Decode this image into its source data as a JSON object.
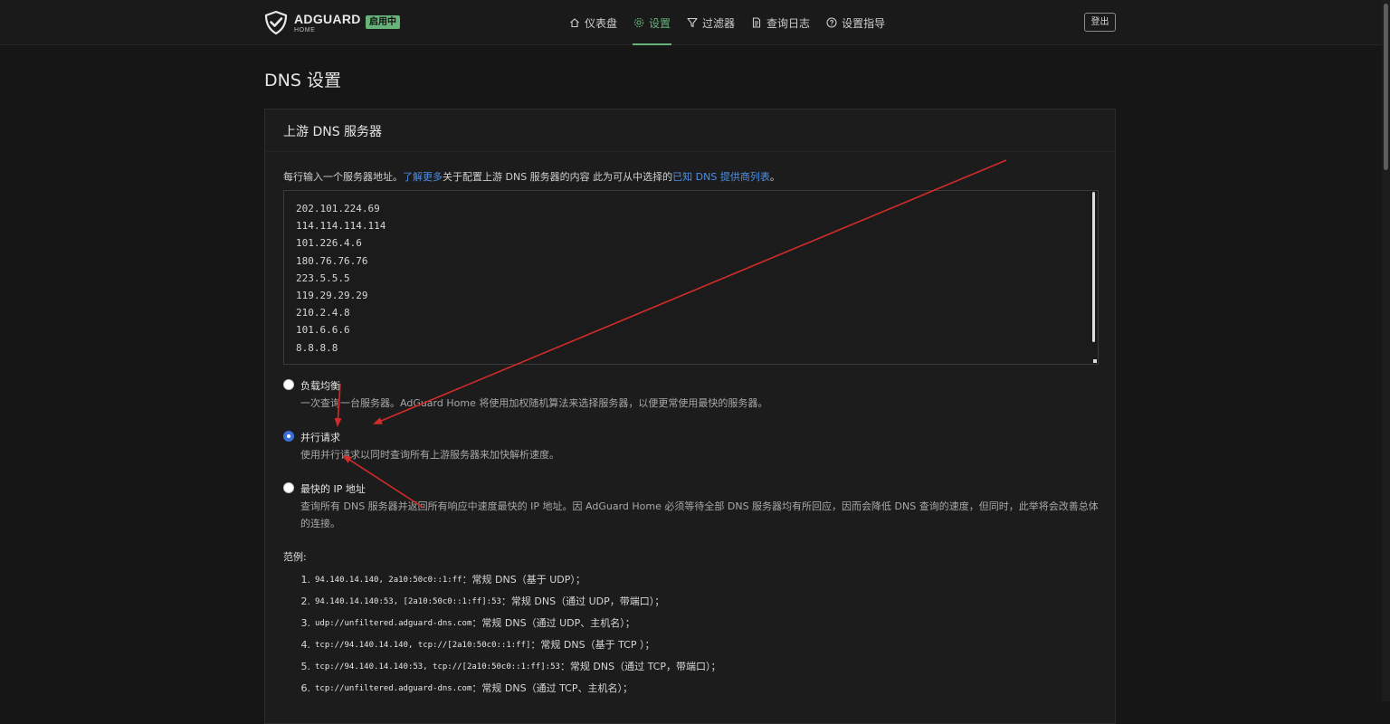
{
  "header": {
    "logo_name": "ADGUARD",
    "logo_sub": "HOME",
    "status_badge": "启用中",
    "nav": [
      {
        "label": "仪表盘",
        "icon": "home-icon"
      },
      {
        "label": "设置",
        "icon": "gear-icon",
        "active": true
      },
      {
        "label": "过滤器",
        "icon": "filter-icon"
      },
      {
        "label": "查询日志",
        "icon": "document-icon"
      },
      {
        "label": "设置指导",
        "icon": "help-icon"
      }
    ],
    "logout_label": "登出"
  },
  "page": {
    "title": "DNS 设置"
  },
  "upstream": {
    "card_title": "上游 DNS 服务器",
    "help_prefix": "每行输入一个服务器地址。",
    "help_link_learn_more": "了解更多",
    "help_middle": "关于配置上游 DNS 服务器的内容 此为可从中选择的",
    "help_link_providers": "已知 DNS 提供商列表",
    "help_suffix": "。",
    "servers": [
      "202.101.224.69",
      "114.114.114.114",
      "101.226.4.6",
      "180.76.76.76",
      "223.5.5.5",
      "119.29.29.29",
      "210.2.4.8",
      "101.6.6.6",
      "8.8.8.8"
    ],
    "modes": [
      {
        "label": "负载均衡",
        "desc": "一次查询一台服务器。AdGuard Home 将使用加权随机算法来选择服务器，以便更常使用最快的服务器。",
        "checked": false
      },
      {
        "label": "并行请求",
        "desc": "使用并行请求以同时查询所有上游服务器来加快解析速度。",
        "checked": true
      },
      {
        "label": "最快的 IP 地址",
        "desc": "查询所有 DNS 服务器并返回所有响应中速度最快的 IP 地址。因 AdGuard Home 必须等待全部 DNS 服务器均有所回应，因而会降低 DNS 查询的速度，但同时，此举将会改善总体的连接。",
        "checked": false
      }
    ],
    "examples_title": "范例:",
    "examples": [
      {
        "num": "1.",
        "code": "94.140.14.140, 2a10:50c0::1:ff",
        "text": "：常规 DNS（基于 UDP）；"
      },
      {
        "num": "2.",
        "code": "94.140.14.140:53, [2a10:50c0::1:ff]:53",
        "text": "：常规 DNS（通过 UDP，带端口）；"
      },
      {
        "num": "3.",
        "code": "udp://unfiltered.adguard-dns.com",
        "text": "：常规 DNS（通过 UDP、主机名）；"
      },
      {
        "num": "4.",
        "code": "tcp://94.140.14.140, tcp://[2a10:50c0::1:ff]",
        "text": "：常规 DNS（基于 TCP ）；"
      },
      {
        "num": "5.",
        "code": "tcp://94.140.14.140:53, tcp://[2a10:50c0::1:ff]:53",
        "text": "：常规 DNS（通过 TCP，带端口）；"
      },
      {
        "num": "6.",
        "code": "tcp://unfiltered.adguard-dns.com",
        "text": "：常规 DNS（通过 TCP、主机名）；"
      }
    ]
  },
  "colors": {
    "accent_green": "#67b279",
    "link_blue": "#4d8fe6",
    "radio_checked": "#3a6fd8",
    "annotation_red": "#d42a2a"
  }
}
